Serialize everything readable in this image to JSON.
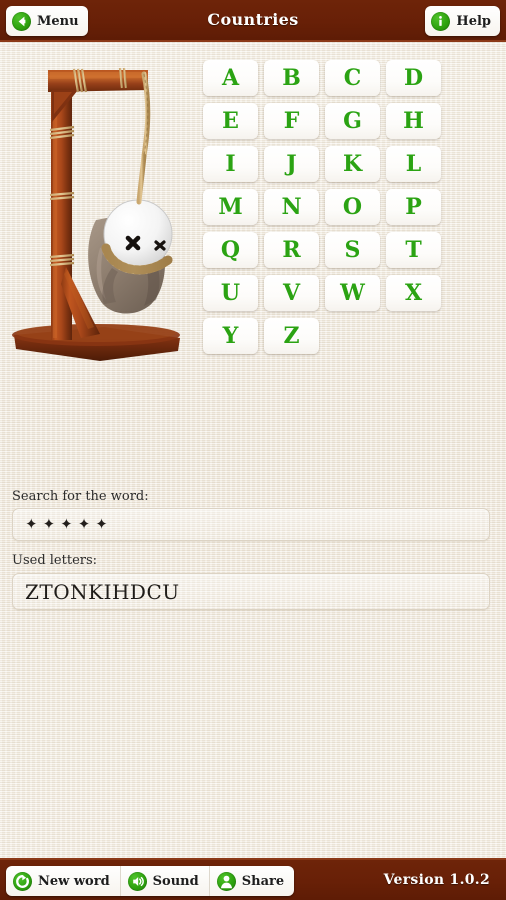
{
  "theme": {
    "header_color": "#6b2208",
    "header_border_color": "#8c3a18",
    "background_color": "#f1ebe0",
    "accent_green": "#2ba313",
    "letter_color": "#2ba313",
    "text_color": "#1d1d1d"
  },
  "header": {
    "title": "Countries",
    "menu_label": "Menu",
    "menu_icon": "back-arrow-icon",
    "help_label": "Help",
    "help_icon": "info-icon"
  },
  "gallows": {
    "alt": "wooden gallows with hanging doll figure",
    "doll_head": "white ball with black x eyes",
    "state": "fully-hanged"
  },
  "keypad": {
    "columns": 4,
    "rows": 7,
    "letters": [
      {
        "letter": "A",
        "used": false
      },
      {
        "letter": "B",
        "used": false
      },
      {
        "letter": "C",
        "used": false
      },
      {
        "letter": "D",
        "used": false
      },
      {
        "letter": "E",
        "used": false
      },
      {
        "letter": "F",
        "used": false
      },
      {
        "letter": "G",
        "used": false
      },
      {
        "letter": "H",
        "used": false
      },
      {
        "letter": "I",
        "used": false
      },
      {
        "letter": "J",
        "used": false
      },
      {
        "letter": "K",
        "used": false
      },
      {
        "letter": "L",
        "used": false
      },
      {
        "letter": "M",
        "used": false
      },
      {
        "letter": "N",
        "used": false
      },
      {
        "letter": "O",
        "used": false
      },
      {
        "letter": "P",
        "used": false
      },
      {
        "letter": "Q",
        "used": false
      },
      {
        "letter": "R",
        "used": false
      },
      {
        "letter": "S",
        "used": false
      },
      {
        "letter": "T",
        "used": false
      },
      {
        "letter": "U",
        "used": false
      },
      {
        "letter": "V",
        "used": false
      },
      {
        "letter": "W",
        "used": false
      },
      {
        "letter": "X",
        "used": false
      },
      {
        "letter": "Y",
        "used": false
      },
      {
        "letter": "Z",
        "used": false
      }
    ]
  },
  "word_section": {
    "search_label": "Search for the word:",
    "masked_word": "✦✦✦✦✦",
    "word_length": 5,
    "used_label": "Used letters:",
    "used_letters": "ZTONKIHDCU"
  },
  "footer": {
    "new_word_label": "New word",
    "new_word_icon": "refresh-icon",
    "sound_label": "Sound",
    "sound_icon": "speaker-icon",
    "share_label": "Share",
    "share_icon": "person-icon",
    "version": "Version 1.0.2"
  }
}
